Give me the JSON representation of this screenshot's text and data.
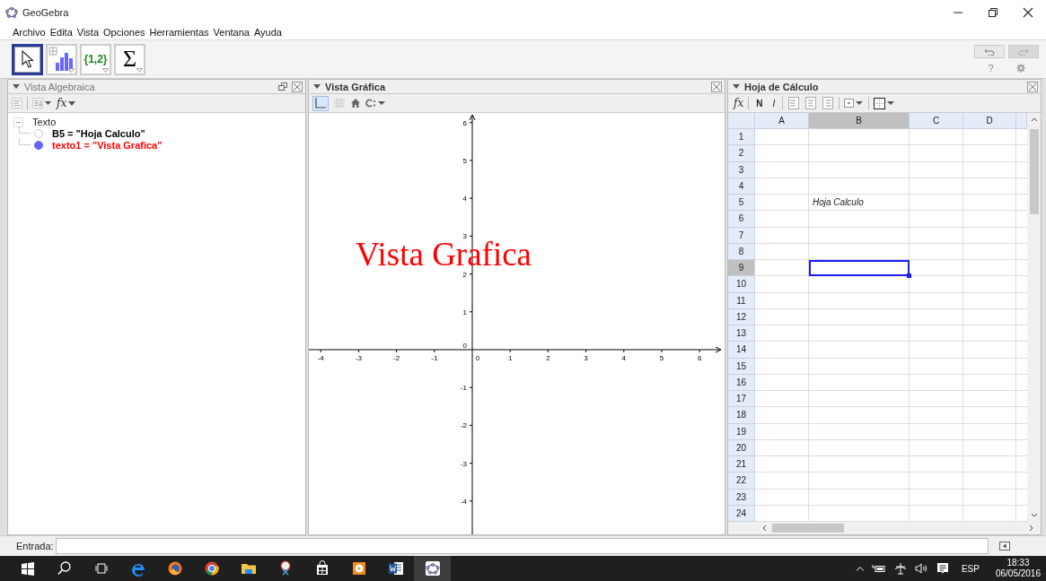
{
  "window": {
    "title": "GeoGebra"
  },
  "menu": [
    "Archivo",
    "Edita",
    "Vista",
    "Opciones",
    "Herramientas",
    "Ventana",
    "Ayuda"
  ],
  "tools": [
    {
      "kind": "move",
      "selected": true
    },
    {
      "kind": "chart",
      "selected": false
    },
    {
      "kind": "list",
      "label": "{1,2}",
      "selected": false
    },
    {
      "kind": "sum",
      "label": "Σ",
      "selected": false
    }
  ],
  "toolbar_right": {
    "help": "?"
  },
  "algebra_view": {
    "title": "Vista Algebraica",
    "active": false,
    "fx": "fx",
    "tree": [
      {
        "text": "Texto",
        "expanded": true,
        "children": [
          {
            "text": "B5 = \"Hoja Calculo\"",
            "shown": false,
            "color": "#000000"
          },
          {
            "text": "texto1 = \"Vista Grafica\"",
            "shown": true,
            "color": "#ff0000"
          }
        ]
      }
    ]
  },
  "graphics_view": {
    "title": "Vista Gráfica",
    "active": true,
    "x_labels_negative": [
      "-4",
      "-3",
      "-2",
      "-1"
    ],
    "x_label_origin": "0",
    "x_labels_positive": [
      "1",
      "2",
      "3",
      "4",
      "5",
      "6"
    ],
    "y_labels_positive": [
      "6",
      "5",
      "4",
      "3",
      "2",
      "1"
    ],
    "y_label_origin": "0",
    "y_labels_negative": [
      "-1",
      "-2",
      "-3",
      "-4"
    ],
    "text_object": {
      "text": "Vista Grafica",
      "color": "#ff0000"
    }
  },
  "spreadsheet": {
    "title": "Hoja de Cálculo",
    "active": true,
    "fx": "fx",
    "bold": "N",
    "italic": "I",
    "columns": [
      {
        "label": "A",
        "selected": false
      },
      {
        "label": "B",
        "selected": true
      },
      {
        "label": "C",
        "selected": false
      },
      {
        "label": "D",
        "selected": false
      }
    ],
    "rows": [
      {
        "label": "1",
        "selected": false
      },
      {
        "label": "2",
        "selected": false
      },
      {
        "label": "3",
        "selected": false
      },
      {
        "label": "4",
        "selected": false
      },
      {
        "label": "5",
        "selected": false,
        "cells": [
          null,
          "Hoja Calculo",
          null,
          null
        ]
      },
      {
        "label": "6",
        "selected": false
      },
      {
        "label": "7",
        "selected": false
      },
      {
        "label": "8",
        "selected": false
      },
      {
        "label": "9",
        "selected": true
      },
      {
        "label": "10",
        "selected": false
      },
      {
        "label": "11",
        "selected": false
      },
      {
        "label": "12",
        "selected": false
      },
      {
        "label": "13",
        "selected": false
      },
      {
        "label": "14",
        "selected": false
      },
      {
        "label": "15",
        "selected": false
      },
      {
        "label": "16",
        "selected": false
      },
      {
        "label": "17",
        "selected": false
      },
      {
        "label": "18",
        "selected": false
      },
      {
        "label": "19",
        "selected": false
      },
      {
        "label": "20",
        "selected": false
      },
      {
        "label": "21",
        "selected": false
      },
      {
        "label": "22",
        "selected": false
      },
      {
        "label": "23",
        "selected": false
      },
      {
        "label": "24",
        "selected": false
      }
    ]
  },
  "input_bar": {
    "label": "Entrada:"
  },
  "taskbar": {
    "apps": [
      {
        "kind": "start",
        "active": false
      },
      {
        "kind": "search",
        "active": false
      },
      {
        "kind": "taskview",
        "active": false
      },
      {
        "kind": "edge",
        "active": false
      },
      {
        "kind": "firefox",
        "active": false
      },
      {
        "kind": "chrome",
        "active": false
      },
      {
        "kind": "explorer",
        "active": false
      },
      {
        "kind": "snipping",
        "active": false
      },
      {
        "kind": "store",
        "active": false
      },
      {
        "kind": "media",
        "active": false
      },
      {
        "kind": "word",
        "active": false
      },
      {
        "kind": "geogebra",
        "active": true
      }
    ],
    "tray": {
      "language": "ESP",
      "time": "18:33",
      "date": "06/05/2016"
    }
  }
}
